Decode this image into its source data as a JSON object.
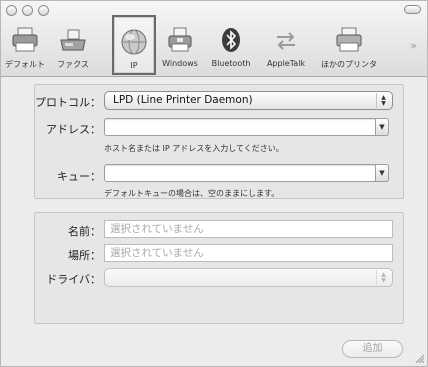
{
  "toolbar": {
    "items": [
      {
        "label": "デフォルト",
        "icon": "printer-icon"
      },
      {
        "label": "ファクス",
        "icon": "fax-icon"
      },
      {
        "label": "IP",
        "icon": "globe-icon",
        "selected": true
      },
      {
        "label": "Windows",
        "icon": "windows-printer-icon"
      },
      {
        "label": "Bluetooth",
        "icon": "bluetooth-icon"
      },
      {
        "label": "AppleTalk",
        "icon": "appletalk-icon"
      },
      {
        "label": "ほかのプリンタ",
        "icon": "printer-icon"
      }
    ],
    "overflow_glyph": "»"
  },
  "ip_panel": {
    "protocol_label": "プロトコル：",
    "protocol_value": "LPD (Line Printer Daemon)",
    "address_label": "アドレス：",
    "address_value": "",
    "address_hint": "ホスト名または IP アドレスを入力してください。",
    "queue_label": "キュー：",
    "queue_value": "",
    "queue_hint": "デフォルトキューの場合は、空のままにします。"
  },
  "info_panel": {
    "name_label": "名前：",
    "name_value": "選択されていません",
    "location_label": "場所：",
    "location_value": "選択されていません",
    "driver_label": "ドライバ：",
    "driver_value": ""
  },
  "footer": {
    "add_button": "追加"
  },
  "colors": {
    "window_bg": "#ececec",
    "selected_border": "#6a6a6a",
    "disabled_text": "#a9a9a9"
  }
}
